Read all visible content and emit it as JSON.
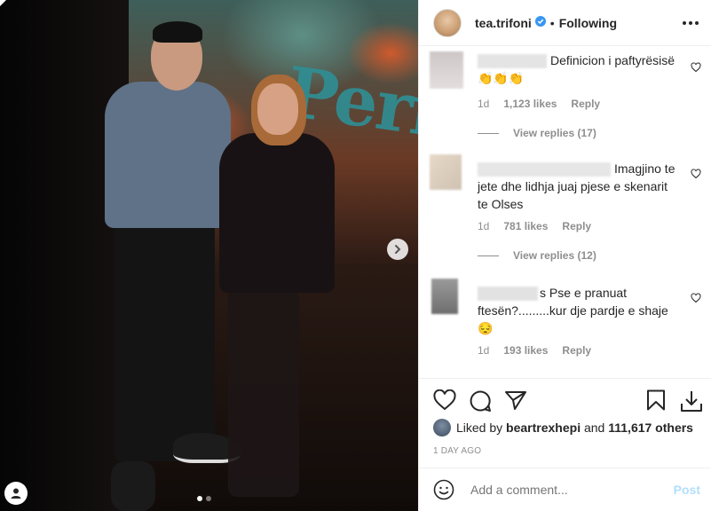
{
  "photo": {
    "wall_text": "Perf",
    "carousel_dots": 2,
    "active_dot": 0
  },
  "header": {
    "username": "tea.trifoni",
    "separator": "•",
    "follow_status": "Following"
  },
  "comments": [
    {
      "text": "Definicion i paftyrësisë👏👏👏",
      "time": "1d",
      "likes": "1,123 likes",
      "reply": "Reply",
      "view_replies": "View replies (17)"
    },
    {
      "text": "Imagjino te jete dhe lidhja juaj pjese e skenarit te Olses",
      "time": "1d",
      "likes": "781 likes",
      "reply": "Reply",
      "view_replies": "View replies (12)"
    },
    {
      "text": "s Pse e pranuat ftesën?.........kur dje pardje e shaje 😔",
      "time": "1d",
      "likes": "193 likes",
      "reply": "Reply"
    }
  ],
  "likes": {
    "prefix": "Liked by",
    "user": "beartrexhepi",
    "conj": "and",
    "others": "111,617 others"
  },
  "post_date": "1 DAY AGO",
  "add_comment": {
    "placeholder": "Add a comment...",
    "post_label": "Post"
  },
  "colors": {
    "verified": "#3897f0",
    "post_disabled": "#b2dffc",
    "meta_gray": "#8e8e8e"
  },
  "icons": [
    "next-arrow-icon",
    "user-tag-icon",
    "verified-icon",
    "more-options-icon",
    "heart-icon",
    "comment-icon",
    "share-icon",
    "bookmark-icon",
    "download-icon",
    "emoji-icon"
  ]
}
